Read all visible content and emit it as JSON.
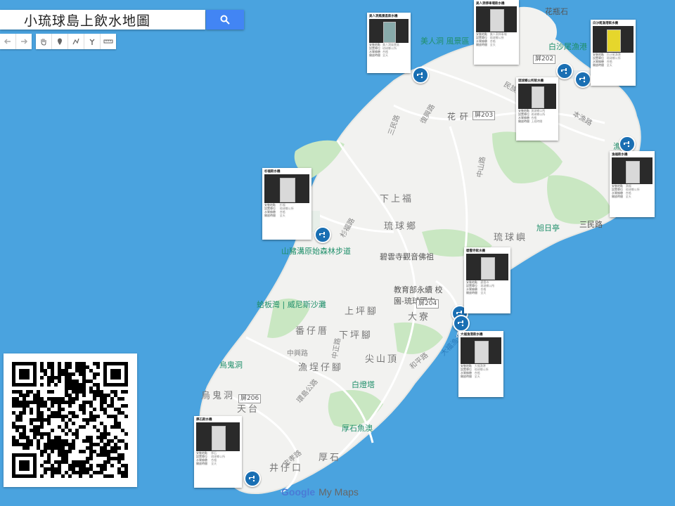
{
  "search": {
    "title": "小琉球島上飲水地圖"
  },
  "toolbar": {
    "tools": [
      "undo-icon",
      "redo-icon",
      "hand-icon",
      "marker-icon",
      "draw-line-icon",
      "directions-icon",
      "ruler-icon"
    ]
  },
  "map_labels": {
    "places": [
      "花 矸",
      "下上福",
      "琉球鄉",
      "琉球嶼",
      "上坪腳",
      "大寮",
      "番仔厝",
      "下坪腳",
      "尖山頂",
      "漁埕仔腳",
      "烏鬼洞",
      "天台",
      "厚石",
      "井仔口"
    ],
    "pois": [
      "花瓶石",
      "美人洞 風景區",
      "白沙尾漁港",
      "漁福",
      "山豬溝原始森林步道",
      "旭日亭",
      "碧雲寺觀音佛祖",
      "教育部永續 校園-琉球國中",
      "蛤板灣 | 威尼斯沙灘",
      "烏鬼洞",
      "白燈塔",
      "厚石魚澳",
      "三民路"
    ],
    "roads": [
      "民族路",
      "本漁路",
      "復興路",
      "環島公路",
      "中山路",
      "忠孝路",
      "和平路",
      "中正路",
      "三民路",
      "杉福路",
      "中興路"
    ],
    "shields": [
      "屏202",
      "屏203",
      "屏204",
      "屏206"
    ],
    "sea": [
      "大福漁港"
    ]
  },
  "stations": [
    {
      "title": "美人洞風景區飲水機",
      "rows": [
        [
          "安裝地點",
          "美人洞風景區"
        ],
        [
          "設置單位",
          "琉球鄉公所"
        ],
        [
          "水質檢驗",
          "合格"
        ],
        [
          "開放時間",
          "全天"
        ]
      ]
    },
    {
      "title": "美人洞停車場飲水機",
      "rows": [
        [
          "安裝地點",
          "美人洞停車場"
        ],
        [
          "設置單位",
          "琉球鄉公所"
        ],
        [
          "水質檢驗",
          "合格"
        ],
        [
          "開放時間",
          "全天"
        ]
      ]
    },
    {
      "title": "白沙尾漁港飲水機",
      "rows": [
        [
          "安裝地點",
          "白沙尾漁港"
        ],
        [
          "設置單位",
          "琉球鄉公所"
        ],
        [
          "水質檢驗",
          "合格"
        ],
        [
          "開放時間",
          "全天"
        ]
      ]
    },
    {
      "title": "琉球鄉公所飲水機",
      "rows": [
        [
          "安裝地點",
          "琉球鄉公所"
        ],
        [
          "設置單位",
          "琉球鄉公所"
        ],
        [
          "水質檢驗",
          "合格"
        ],
        [
          "開放時間",
          "上班時間"
        ]
      ]
    },
    {
      "title": "漁福飲水機",
      "rows": [
        [
          "安裝地點",
          "漁福"
        ],
        [
          "設置單位",
          "琉球鄉公所"
        ],
        [
          "水質檢驗",
          "合格"
        ],
        [
          "開放時間",
          "全天"
        ]
      ]
    },
    {
      "title": "杉福飲水機",
      "rows": [
        [
          "安裝地點",
          "杉福"
        ],
        [
          "設置單位",
          "琉球鄉公所"
        ],
        [
          "水質檢驗",
          "合格"
        ],
        [
          "開放時間",
          "全天"
        ]
      ]
    },
    {
      "title": "碧雲寺飲水機",
      "rows": [
        [
          "安裝地點",
          "碧雲寺"
        ],
        [
          "設置單位",
          "琉球鄉公所"
        ],
        [
          "水質檢驗",
          "合格"
        ],
        [
          "開放時間",
          "全天"
        ]
      ]
    },
    {
      "title": "大福漁港飲水機",
      "rows": [
        [
          "安裝地點",
          "大福漁港"
        ],
        [
          "設置單位",
          "琉球鄉公所"
        ],
        [
          "水質檢驗",
          "合格"
        ],
        [
          "開放時間",
          "全天"
        ]
      ]
    },
    {
      "title": "厚石飲水機",
      "rows": [
        [
          "安裝地點",
          "厚石"
        ],
        [
          "設置單位",
          "琉球鄉公所"
        ],
        [
          "水質檢驗",
          "合格"
        ],
        [
          "開放時間",
          "全天"
        ]
      ]
    }
  ],
  "footer": {
    "brand_google": "Google",
    "brand_maps": "My Maps"
  },
  "colors": {
    "sea": "#4aa3df",
    "land": "#f2f2f0",
    "green": "#c9e7c2",
    "accent": "#4285f4",
    "tap": "#1a6fb3"
  }
}
